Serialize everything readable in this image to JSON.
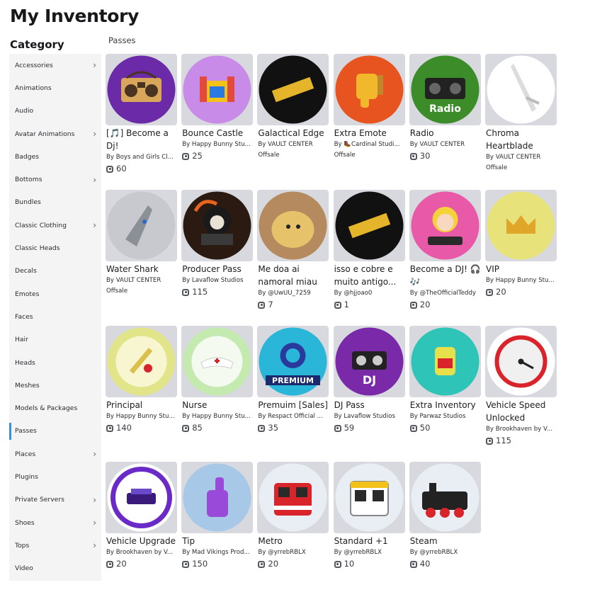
{
  "page": {
    "title": "My Inventory"
  },
  "sidebar": {
    "heading": "Category",
    "items": [
      {
        "label": "Accessories",
        "chevron": true,
        "active": false
      },
      {
        "label": "Animations",
        "chevron": false,
        "active": false
      },
      {
        "label": "Audio",
        "chevron": false,
        "active": false
      },
      {
        "label": "Avatar Animations",
        "chevron": true,
        "active": false
      },
      {
        "label": "Badges",
        "chevron": false,
        "active": false
      },
      {
        "label": "Bottoms",
        "chevron": true,
        "active": false
      },
      {
        "label": "Bundles",
        "chevron": false,
        "active": false
      },
      {
        "label": "Classic Clothing",
        "chevron": true,
        "active": false
      },
      {
        "label": "Classic Heads",
        "chevron": false,
        "active": false
      },
      {
        "label": "Decals",
        "chevron": false,
        "active": false
      },
      {
        "label": "Emotes",
        "chevron": false,
        "active": false
      },
      {
        "label": "Faces",
        "chevron": false,
        "active": false
      },
      {
        "label": "Hair",
        "chevron": false,
        "active": false
      },
      {
        "label": "Heads",
        "chevron": false,
        "active": false
      },
      {
        "label": "Meshes",
        "chevron": false,
        "active": false
      },
      {
        "label": "Models & Packages",
        "chevron": false,
        "active": false
      },
      {
        "label": "Passes",
        "chevron": false,
        "active": true
      },
      {
        "label": "Places",
        "chevron": true,
        "active": false
      },
      {
        "label": "Plugins",
        "chevron": false,
        "active": false
      },
      {
        "label": "Private Servers",
        "chevron": true,
        "active": false
      },
      {
        "label": "Shoes",
        "chevron": true,
        "active": false
      },
      {
        "label": "Tops",
        "chevron": true,
        "active": false
      },
      {
        "label": "Video",
        "chevron": false,
        "active": false
      }
    ]
  },
  "section": {
    "label": "Passes"
  },
  "passes": [
    {
      "name": "[🎵] Become a Dj!",
      "by": "By",
      "creator": "Boys and Girls Cl...",
      "price": "60",
      "offsale": "",
      "icon": "boombox-icon",
      "bg": "#6b2aa8",
      "fg": "#d9a75c"
    },
    {
      "name": "Bounce Castle",
      "by": "By",
      "creator": "Happy Bunny Stu...",
      "price": "25",
      "offsale": "",
      "icon": "bounce-castle-icon",
      "bg": "#c98be8",
      "fg": "#e24a3b"
    },
    {
      "name": "Galactical Edge",
      "by": "By",
      "creator": "VAULT CENTER",
      "price": "",
      "offsale": "Offsale",
      "icon": "gold-bar-icon",
      "bg": "#111111",
      "fg": "#e4b52a"
    },
    {
      "name": "Extra Emote",
      "by": "By",
      "creator": "🥾Cardinal Studi...",
      "price": "",
      "offsale": "Offsale",
      "icon": "thumbs-down-icon",
      "bg": "#e8541f",
      "fg": "#f2b82c"
    },
    {
      "name": "Radio",
      "by": "By",
      "creator": "VAULT CENTER",
      "price": "30",
      "offsale": "",
      "icon": "radio-icon",
      "bg": "#3d8c2a",
      "fg": "#222222"
    },
    {
      "name": "Chroma Heartblade",
      "by": "By",
      "creator": "VAULT CENTER",
      "price": "",
      "offsale": "Offsale",
      "icon": "sword-icon",
      "bg": "#ffffff",
      "fg": "#dcdcdc"
    },
    {
      "name": "Water Shark",
      "by": "By",
      "creator": "VAULT CENTER",
      "price": "",
      "offsale": "Offsale",
      "icon": "shark-icon",
      "bg": "#c8c9ce",
      "fg": "#8a9096"
    },
    {
      "name": "Producer Pass",
      "by": "By",
      "creator": "Lavaflow Studios",
      "price": "115",
      "offsale": "",
      "icon": "grim-reaper-icon",
      "bg": "#2a1a12",
      "fg": "#e8641c"
    },
    {
      "name": "Me doa ai namoral miau",
      "by": "By",
      "creator": "@UwUU_7259",
      "price": "7",
      "offsale": "",
      "icon": "cat-photo-icon",
      "bg": "#b48a5e",
      "fg": "#e6c26a"
    },
    {
      "name": "isso e cobre e muito antigo...",
      "by": "By",
      "creator": "@hjjoao0",
      "price": "1",
      "offsale": "",
      "icon": "gold-bar-icon",
      "bg": "#111111",
      "fg": "#e4b52a"
    },
    {
      "name": "Become a DJ! 🎧🎶",
      "by": "By",
      "creator": "@TheOfficialTeddy",
      "price": "20",
      "offsale": "",
      "icon": "anime-dj-icon",
      "bg": "#e85aa8",
      "fg": "#f6d23a"
    },
    {
      "name": "VIP",
      "by": "By",
      "creator": "Happy Bunny Stu...",
      "price": "20",
      "offsale": "",
      "icon": "crown-icon",
      "bg": "#e8e27a",
      "fg": "#e0a62a"
    },
    {
      "name": "Principal",
      "by": "By",
      "creator": "Happy Bunny Stu...",
      "price": "140",
      "offsale": "",
      "icon": "ruler-apple-icon",
      "bg": "#e2e48a",
      "fg": "#d8c04a"
    },
    {
      "name": "Nurse",
      "by": "By",
      "creator": "Happy Bunny Stu...",
      "price": "85",
      "offsale": "",
      "icon": "nurse-cap-icon",
      "bg": "#c4eab0",
      "fg": "#ffffff"
    },
    {
      "name": "Premuim [Sales]",
      "by": "By",
      "creator": "Respact Official ...",
      "price": "35",
      "offsale": "",
      "icon": "premium-badge-icon",
      "bg": "#2ab6d8",
      "fg": "#2a3a9c"
    },
    {
      "name": "DJ Pass",
      "by": "By",
      "creator": "Lavaflow Studios",
      "price": "59",
      "offsale": "",
      "icon": "dj-controller-icon",
      "bg": "#7a2aa8",
      "fg": "#222222"
    },
    {
      "name": "Extra Inventory",
      "by": "By",
      "creator": "Parwaz Studios",
      "price": "50",
      "offsale": "",
      "icon": "backpack-icon",
      "bg": "#2ec4b8",
      "fg": "#e8e04a"
    },
    {
      "name": "Vehicle Speed Unlocked",
      "by": "By",
      "creator": "Brookhaven by V...",
      "price": "115",
      "offsale": "",
      "icon": "speedometer-icon",
      "bg": "#ffffff",
      "fg": "#d8242a"
    },
    {
      "name": "Vehicle Upgrade",
      "by": "By",
      "creator": "Brookhaven by V...",
      "price": "20",
      "offsale": "",
      "icon": "vehicle-upgrade-icon",
      "bg": "#ffffff",
      "fg": "#6a2ac8"
    },
    {
      "name": "Tip",
      "by": "By",
      "creator": "Mad Vikings Prod...",
      "price": "150",
      "offsale": "",
      "icon": "thumbs-up-icon",
      "bg": "#a8c8e8",
      "fg": "#9a4ad8"
    },
    {
      "name": "Metro",
      "by": "By",
      "creator": "@yrrebRBLX",
      "price": "20",
      "offsale": "",
      "icon": "metro-train-icon",
      "bg": "#e8eef4",
      "fg": "#d8242a"
    },
    {
      "name": "Standard +1",
      "by": "By",
      "creator": "@yrrebRBLX",
      "price": "10",
      "offsale": "",
      "icon": "standard-train-icon",
      "bg": "#e8eef4",
      "fg": "#f2c21a"
    },
    {
      "name": "Steam",
      "by": "By",
      "creator": "@yrrebRBLX",
      "price": "40",
      "offsale": "",
      "icon": "steam-locomotive-icon",
      "bg": "#e8eef4",
      "fg": "#222222"
    }
  ]
}
